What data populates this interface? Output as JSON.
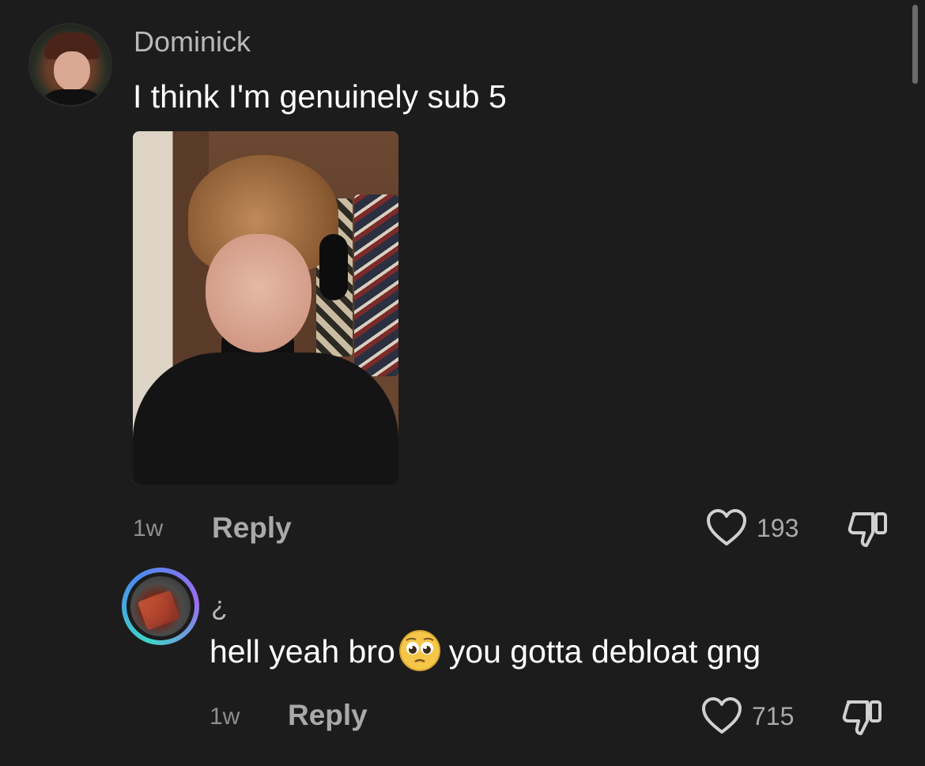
{
  "comment": {
    "username": "Dominick",
    "text": "I think I'm genuinely sub 5",
    "time": "1w",
    "reply_label": "Reply",
    "likes": "193",
    "has_photo": true
  },
  "reply": {
    "username": "¿",
    "text_before": "hell yeah bro",
    "emoji": "pleading-face",
    "text_after": "you gotta debloat gng",
    "time": "1w",
    "reply_label": "Reply",
    "likes": "715"
  },
  "icons": {
    "like": "heart-outline-icon",
    "dislike": "thumbs-down-outline-icon"
  },
  "colors": {
    "background": "#1c1c1c",
    "text": "#ffffff",
    "secondary_text": "#a9a9a9",
    "reply_avatar_ring": "#3fd5c7"
  }
}
